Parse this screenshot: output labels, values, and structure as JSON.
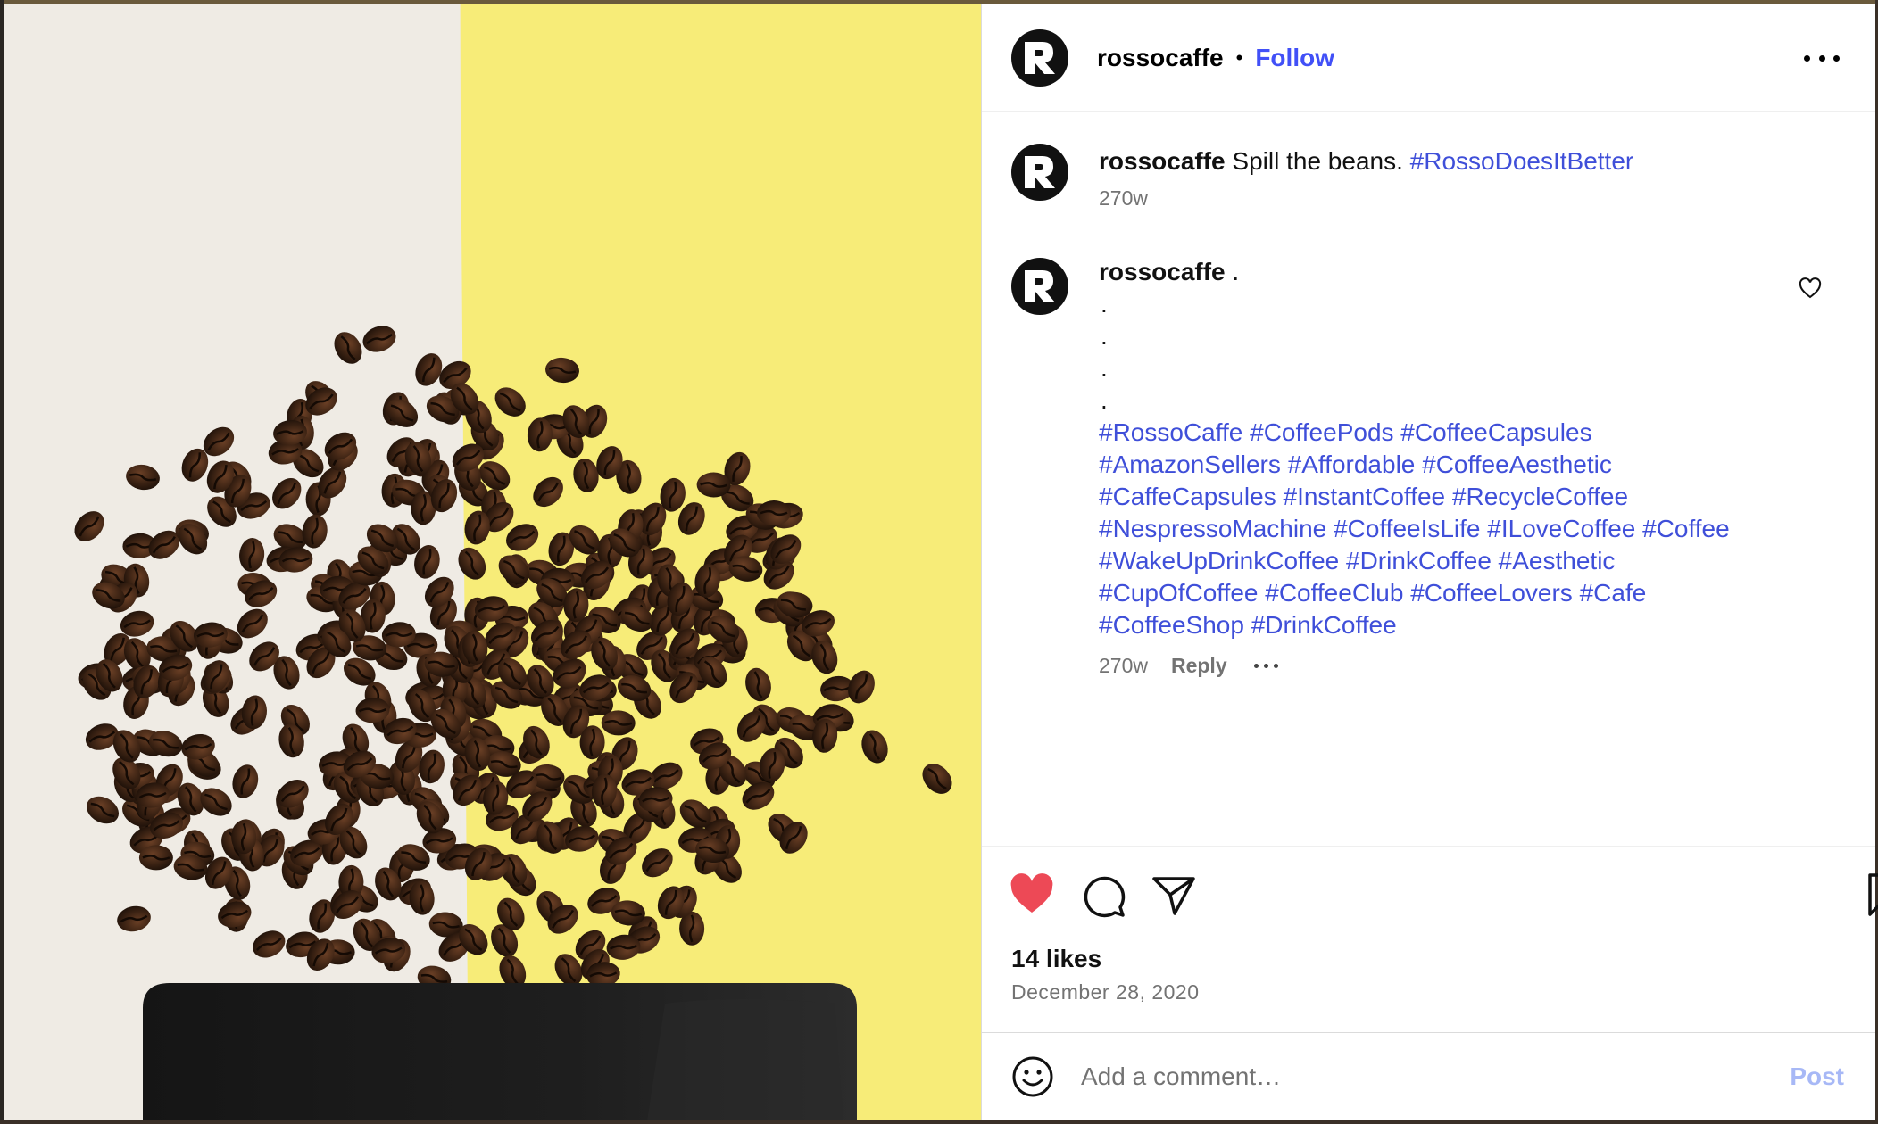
{
  "post": {
    "username": "rossocaffe",
    "separator": "•",
    "follow_label": "Follow",
    "colors": {
      "link": "#3f4fd9",
      "follow": "#4150f7",
      "liked_heart": "#ed4956",
      "muted": "#737373",
      "post_disabled": "#a7b8f6"
    }
  },
  "caption": {
    "username": "rossocaffe",
    "text": " Spill the beans. ",
    "hashtag": "#RossoDoesItBetter",
    "age": "270w"
  },
  "comment": {
    "username": "rossocaffe",
    "first_line": " .",
    "dot_lines": [
      ".",
      ".",
      ".",
      "."
    ],
    "hashtag_lines": [
      "#RossoCaffe #CoffeePods #CoffeeCapsules",
      "#AmazonSellers #Affordable #CoffeeAesthetic",
      "#CaffeCapsules #InstantCoffee #RecycleCoffee",
      "#NespressoMachine #CoffeeIsLife #ILoveCoffee #Coffee",
      "#WakeUpDrinkCoffee #DrinkCoffee #Aesthetic",
      "#CupOfCoffee #CoffeeClub #CoffeeLovers #Cafe",
      "#CoffeeShop #DrinkCoffee"
    ],
    "age": "270w",
    "reply_label": "Reply",
    "like_icon": "heart-outline-icon"
  },
  "actions": {
    "like_icon": "heart-filled-icon",
    "comment_icon": "speech-bubble-icon",
    "share_icon": "paper-plane-icon",
    "save_icon": "bookmark-icon",
    "likes_text": "14 likes",
    "date": "December 28, 2020"
  },
  "add_comment": {
    "emoji_icon": "smiley-icon",
    "placeholder": "Add a comment…",
    "post_label": "Post"
  }
}
